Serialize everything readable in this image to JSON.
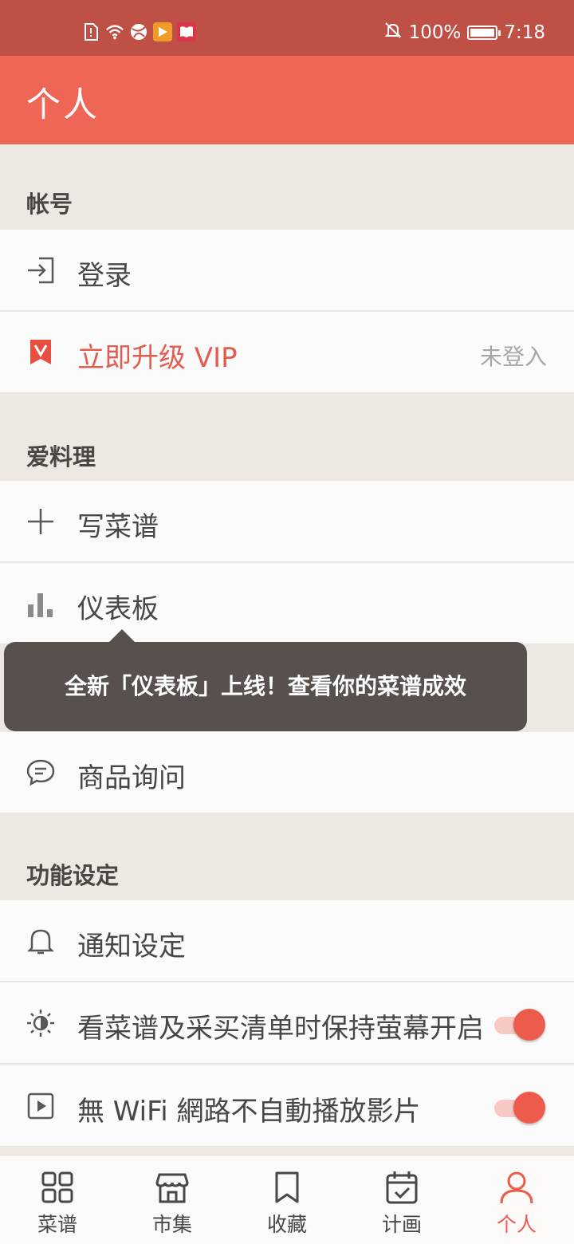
{
  "status_bar": {
    "battery_text": "100%",
    "time": "7:18",
    "left_icons": [
      "alert-icon",
      "wifi-icon",
      "app-icon-ball",
      "app-icon-play",
      "app-icon-book"
    ]
  },
  "app_bar": {
    "title": "个人"
  },
  "sections": {
    "account": {
      "header": "帐号",
      "login_label": "登录",
      "vip_label": "立即升级 VIP",
      "vip_status": "未登入"
    },
    "cooking": {
      "header": "爱料理",
      "write_recipe_label": "写菜谱",
      "dashboard_label": "仪表板",
      "product_inquiry_label": "商品询问"
    },
    "settings": {
      "header": "功能设定",
      "notification_label": "通知设定",
      "keep_screen_on_label": "看菜谱及采买清单时保持萤幕开启",
      "no_wifi_autoplay_label": "無 WiFi 網路不自動播放影片",
      "keep_screen_on_enabled": true,
      "no_wifi_autoplay_enabled": true
    }
  },
  "tooltip": {
    "text": "全新「仪表板」上线！查看你的菜谱成效"
  },
  "bottom_nav": {
    "items": [
      {
        "label": "菜谱",
        "icon": "grid-icon"
      },
      {
        "label": "市集",
        "icon": "store-icon"
      },
      {
        "label": "收藏",
        "icon": "bookmark-icon"
      },
      {
        "label": "计画",
        "icon": "calendar-icon"
      },
      {
        "label": "个人",
        "icon": "person-icon"
      }
    ],
    "active_index": 4
  },
  "colors": {
    "brand": "#ef6556",
    "status_bar": "#bf5045",
    "accent": "#ec5b4c",
    "section_bg": "#ede8e2",
    "tooltip_bg": "#57504d"
  }
}
